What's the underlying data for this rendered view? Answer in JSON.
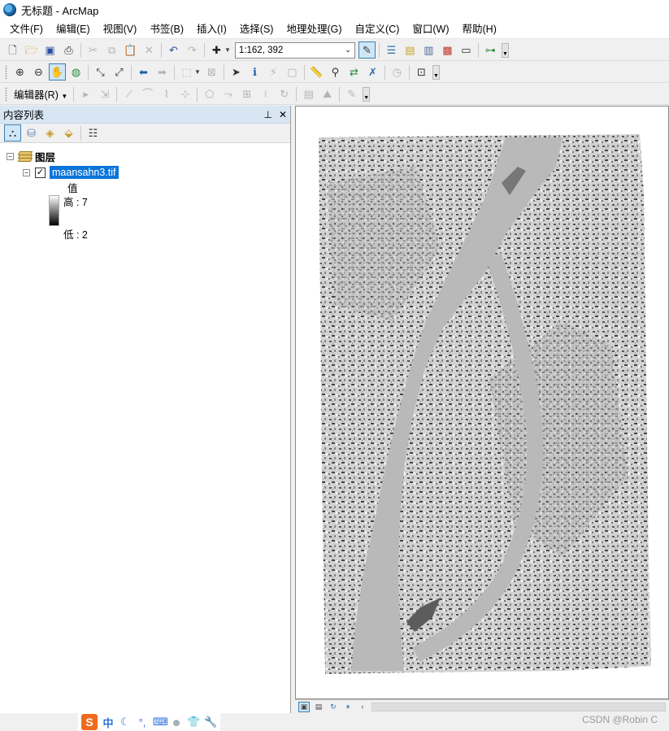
{
  "window": {
    "title": "无标题 - ArcMap",
    "app_icon": "arcmap-globe-icon"
  },
  "menubar": {
    "items": [
      {
        "label": "文件(F)"
      },
      {
        "label": "编辑(E)"
      },
      {
        "label": "视图(V)"
      },
      {
        "label": "书签(B)"
      },
      {
        "label": "插入(I)"
      },
      {
        "label": "选择(S)"
      },
      {
        "label": "地理处理(G)"
      },
      {
        "label": "自定义(C)"
      },
      {
        "label": "窗口(W)"
      },
      {
        "label": "帮助(H)"
      }
    ]
  },
  "toolbar": {
    "scale_value": "1:162, 392",
    "editor_label": "编辑器(R)"
  },
  "toc": {
    "title": "内容列表",
    "pin_glyph": "ᵖ",
    "close_glyph": "✕",
    "root_label": "图层",
    "layer": {
      "name": "maansahn3.tif",
      "checked": true,
      "legend_title": "值",
      "high_label": "高 : 7",
      "low_label": "低 : 2"
    }
  },
  "map": {
    "colors": {
      "background": "#ffffff",
      "water": "#b9b9b9",
      "land_light": "#d4d4d4",
      "land_dark": "#6a6a6a"
    }
  },
  "watermark": "CSDN @Robin C"
}
